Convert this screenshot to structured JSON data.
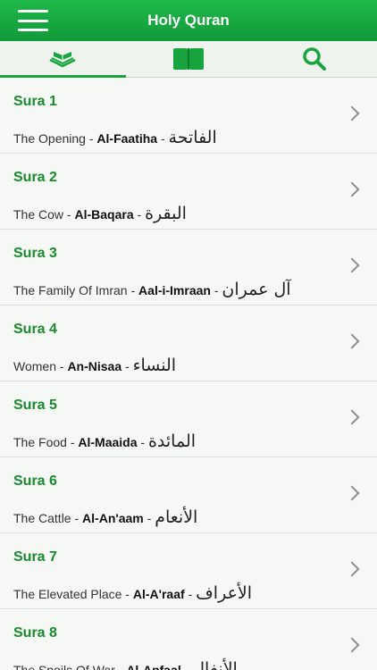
{
  "header": {
    "title": "Holy Quran"
  },
  "tabs": [
    {
      "name": "Quran"
    },
    {
      "name": "Book"
    },
    {
      "name": "Search"
    }
  ],
  "colors": {
    "accent": "#17a33e",
    "title_green": "#1d8a32"
  },
  "suras": [
    {
      "label": "Sura 1",
      "english": "The Opening",
      "translit": "Al-Faatiha",
      "arabic": "الفاتحة"
    },
    {
      "label": "Sura 2",
      "english": "The Cow",
      "translit": "Al-Baqara",
      "arabic": "البقرة"
    },
    {
      "label": "Sura 3",
      "english": "The Family Of Imran",
      "translit": "Aal-i-Imraan",
      "arabic": "آل عمران"
    },
    {
      "label": "Sura 4",
      "english": "Women",
      "translit": "An-Nisaa",
      "arabic": "النساء"
    },
    {
      "label": "Sura 5",
      "english": "The Food",
      "translit": "Al-Maaida",
      "arabic": "المائدة"
    },
    {
      "label": "Sura 6",
      "english": "The Cattle",
      "translit": "Al-An'aam",
      "arabic": "الأنعام"
    },
    {
      "label": "Sura 7",
      "english": "The Elevated Place",
      "translit": "Al-A'raaf",
      "arabic": "الأعراف"
    },
    {
      "label": "Sura 8",
      "english": "The Spoils Of War",
      "translit": "Al-Anfaal",
      "arabic": "الأنفال"
    }
  ]
}
